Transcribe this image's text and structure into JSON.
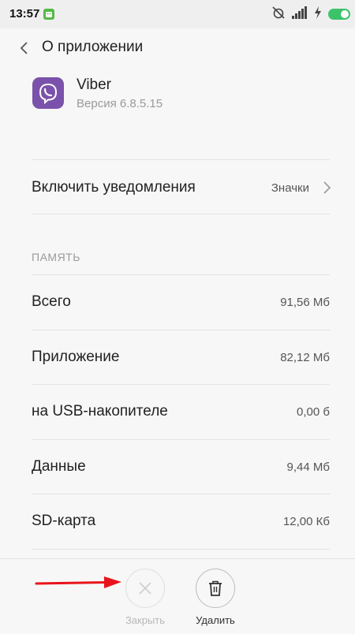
{
  "status_bar": {
    "time": "13:57",
    "app_icon": "android-robot-icon",
    "icons": [
      "alarm-off-icon",
      "signal-icon",
      "charging-icon",
      "battery-toggle-icon"
    ],
    "battery_color": "#3cc36a"
  },
  "header": {
    "title": "О приложении",
    "back_icon": "chevron-left-icon"
  },
  "app": {
    "name": "Viber",
    "version": "Версия 6.8.5.15",
    "icon": "viber-icon",
    "icon_color": "#7b52ab"
  },
  "notifications": {
    "label": "Включить уведомления",
    "value": "Значки"
  },
  "memory": {
    "section_title": "ПАМЯТЬ",
    "rows": [
      {
        "label": "Всего",
        "value": "91,56 Мб"
      },
      {
        "label": "Приложение",
        "value": "82,12 Мб"
      },
      {
        "label": "на USB-накопителе",
        "value": "0,00 б"
      },
      {
        "label": "Данные",
        "value": "9,44 Мб"
      },
      {
        "label": "SD-карта",
        "value": "12,00 Кб"
      }
    ]
  },
  "actions": {
    "close_label": "Закрыть",
    "delete_label": "Удалить",
    "arrow_color": "#e8141b"
  }
}
